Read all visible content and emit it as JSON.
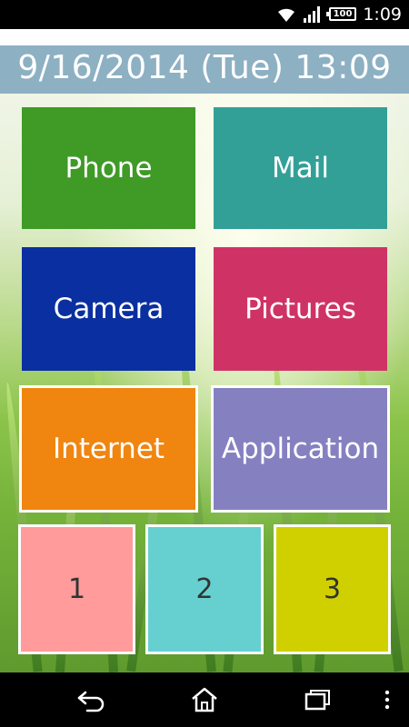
{
  "status": {
    "time": "1:09",
    "battery": "100"
  },
  "date_bar": {
    "text": "9/16/2014 (Tue) 13:09"
  },
  "tiles": [
    {
      "label": "Phone",
      "color": "#3f9a26"
    },
    {
      "label": "Mail",
      "color": "#33a098"
    },
    {
      "label": "Camera",
      "color": "#0a2fa0"
    },
    {
      "label": "Pictures",
      "color": "#cf3366"
    },
    {
      "label": "Internet",
      "color": "#f0850f"
    },
    {
      "label": "Application",
      "color": "#8581c1"
    }
  ],
  "small_tiles": [
    {
      "label": "1",
      "color": "#ff9b9b"
    },
    {
      "label": "2",
      "color": "#66d0d0"
    },
    {
      "label": "3",
      "color": "#d0d000"
    }
  ],
  "nav": {
    "icons": [
      "back-icon",
      "home-icon",
      "recent-apps-icon",
      "overflow-menu-icon"
    ]
  }
}
